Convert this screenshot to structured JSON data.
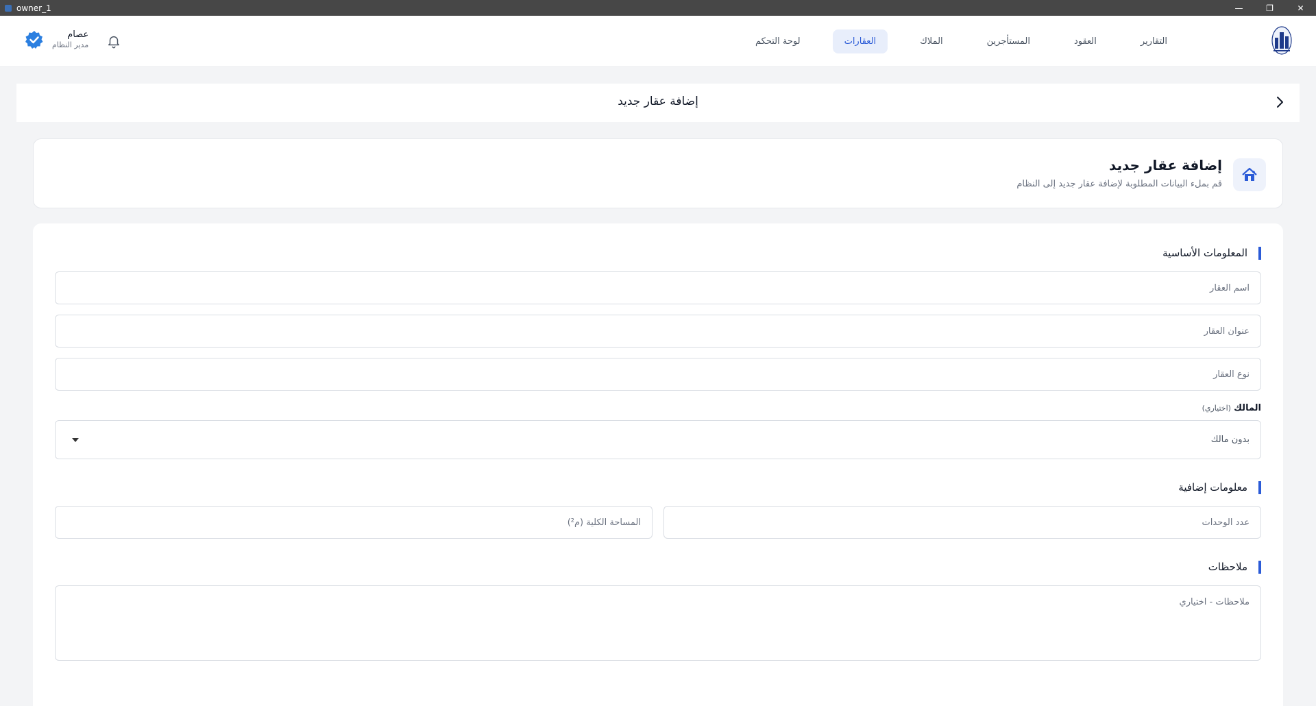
{
  "window": {
    "title": "owner_1",
    "minimize_glyph": "—",
    "restore_glyph": "❐",
    "close_glyph": "✕"
  },
  "nav": {
    "items": [
      {
        "label": "لوحة التحكم",
        "active": false
      },
      {
        "label": "العقارات",
        "active": true
      },
      {
        "label": "الملاك",
        "active": false
      },
      {
        "label": "المستأجرين",
        "active": false
      },
      {
        "label": "العقود",
        "active": false
      },
      {
        "label": "التقارير",
        "active": false
      }
    ]
  },
  "user": {
    "name": "عصام",
    "role": "مدير النظام"
  },
  "page_header": {
    "title": "إضافة عقار جديد"
  },
  "intro": {
    "title": "إضافة عقار جديد",
    "subtitle": "قم بملء البيانات المطلوبة لإضافة عقار جديد إلى النظام"
  },
  "form": {
    "basic_section": "المعلومات الأساسية",
    "name_placeholder": "اسم العقار",
    "address_placeholder": "عنوان العقار",
    "type_placeholder": "نوع العقار",
    "owner_label": "المالك",
    "owner_optional": "(اختياري)",
    "owner_value": "بدون مالك",
    "extra_section": "معلومات إضافية",
    "units_placeholder": "عدد الوحدات",
    "area_placeholder": "المساحة الكلية (م²)",
    "notes_section": "ملاحظات",
    "notes_placeholder": "ملاحظات - اختياري"
  },
  "colors": {
    "accent": "#2b5bd7",
    "active_tab_bg": "#e8eefb",
    "titlebar": "#474747"
  }
}
